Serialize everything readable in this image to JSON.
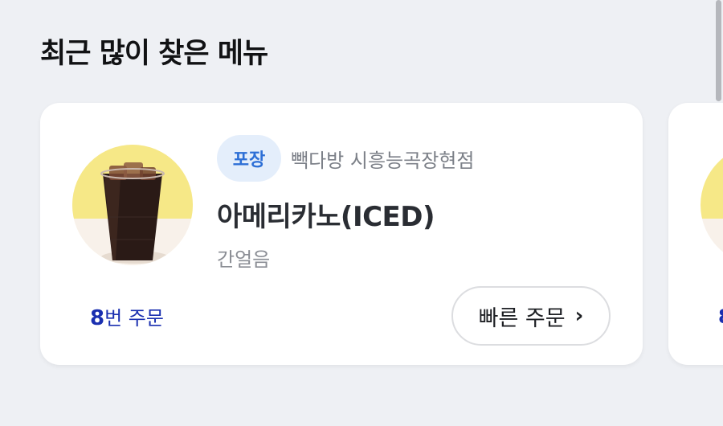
{
  "section": {
    "title": "최근 많이 찾은 메뉴"
  },
  "cards": [
    {
      "badge": "포장",
      "store": "빽다방 시흥능곡장현점",
      "menu_name": "아메리카노(ICED)",
      "option": "간얼음",
      "order_count_number": "8",
      "order_count_suffix": "번 주문",
      "quick_order_label": "빠른 주문",
      "thumbnail_icon": "iced-americano-image"
    },
    {
      "order_count_number": "8"
    }
  ],
  "colors": {
    "background": "#eef0f4",
    "badge_bg": "#e4eefb",
    "badge_text": "#2d6fd6",
    "order_count": "#1a2fb0",
    "thumb_yellow": "#f6e887"
  }
}
